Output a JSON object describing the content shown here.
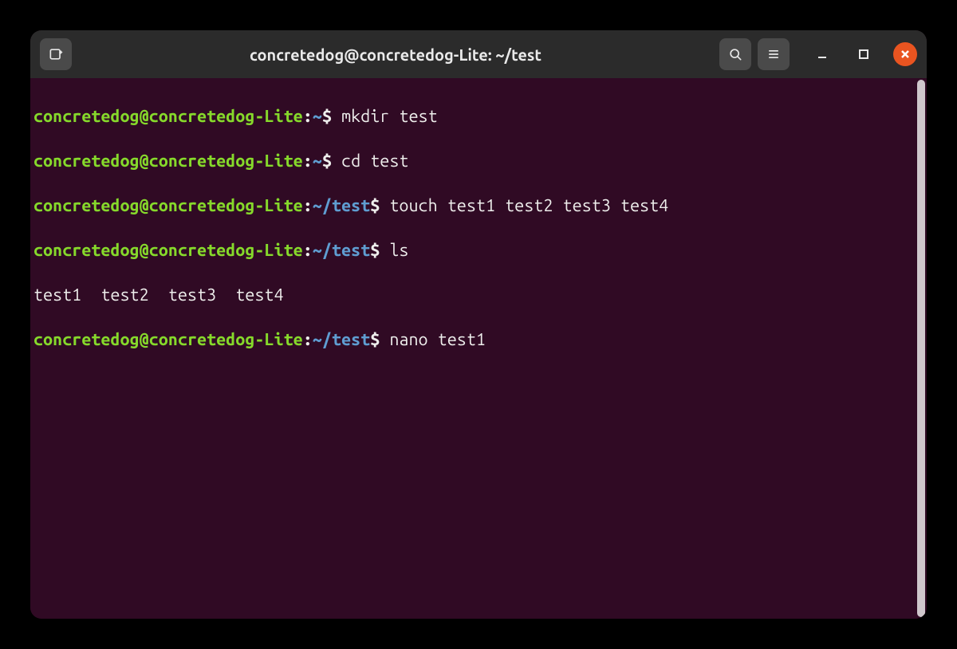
{
  "window": {
    "title": "concretedog@concretedog-Lite: ~/test"
  },
  "icons": {
    "new_tab": "new-tab-icon",
    "search": "search-icon",
    "menu": "hamburger-icon",
    "minimize": "minimize-icon",
    "maximize": "maximize-icon",
    "close": "close-icon"
  },
  "colors": {
    "terminal_bg": "#300a24",
    "titlebar_bg": "#2b2b2b",
    "close_bg": "#e95420",
    "prompt_user": "#86d92b",
    "prompt_path": "#5f9dd1",
    "text": "#eeeeec"
  },
  "lines": [
    {
      "user_host": "concretedog@concretedog-Lite",
      "sep": ":",
      "path": "~",
      "dollar": "$",
      "command": "mkdir test"
    },
    {
      "user_host": "concretedog@concretedog-Lite",
      "sep": ":",
      "path": "~",
      "dollar": "$",
      "command": "cd test"
    },
    {
      "user_host": "concretedog@concretedog-Lite",
      "sep": ":",
      "path": "~/test",
      "dollar": "$",
      "command": "touch test1 test2 test3 test4"
    },
    {
      "user_host": "concretedog@concretedog-Lite",
      "sep": ":",
      "path": "~/test",
      "dollar": "$",
      "command": "ls"
    },
    {
      "output": "test1  test2  test3  test4"
    },
    {
      "user_host": "concretedog@concretedog-Lite",
      "sep": ":",
      "path": "~/test",
      "dollar": "$",
      "command": "nano test1"
    }
  ]
}
